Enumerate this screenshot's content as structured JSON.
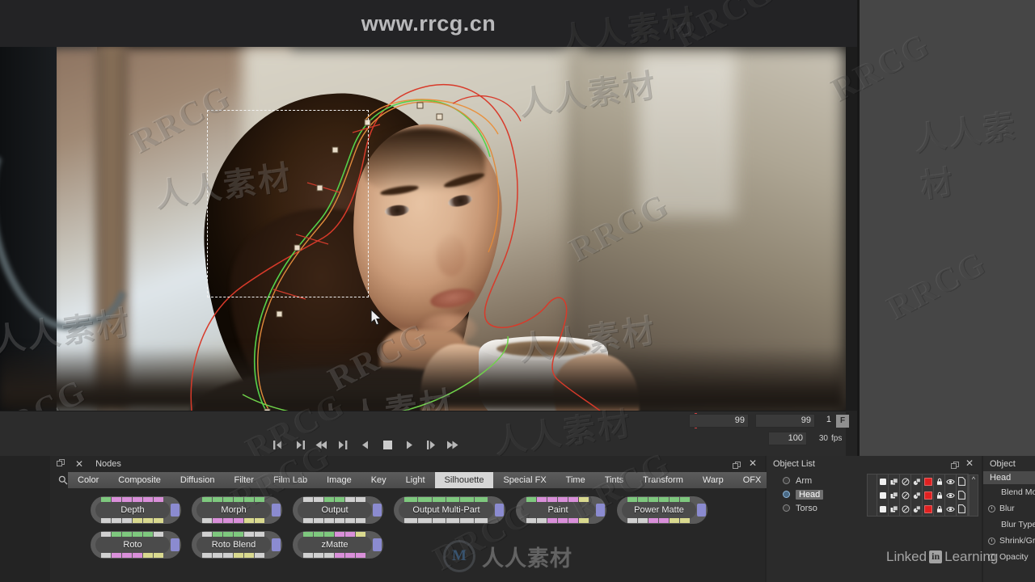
{
  "header": {
    "watermark": "www.rrcg.cn"
  },
  "viewer": {
    "marquee_label": "selection-marquee"
  },
  "transport": {
    "buttons": [
      {
        "name": "go-to-start",
        "glyph": "|◀"
      },
      {
        "name": "go-to-end",
        "glyph": "▶|"
      },
      {
        "name": "rewind",
        "glyph": "◀◀"
      },
      {
        "name": "step-back",
        "glyph": "◀|"
      },
      {
        "name": "play-backward",
        "glyph": "◀"
      },
      {
        "name": "stop",
        "glyph": "■"
      },
      {
        "name": "play-forward",
        "glyph": "▶"
      },
      {
        "name": "step-forward",
        "glyph": "|▶"
      },
      {
        "name": "fast-forward",
        "glyph": "▶▶"
      }
    ],
    "current_frame": "99",
    "end_frame": "99",
    "increment": "1",
    "unit_label": "F",
    "total_frames": "100",
    "fps_value": "30",
    "fps_label": "fps"
  },
  "nodes_panel": {
    "title": "Nodes",
    "search_icon": "search-icon",
    "float_icon": "float-panel-icon",
    "close_icon": "close-icon",
    "tabs": [
      {
        "label": "Color",
        "active": false
      },
      {
        "label": "Composite",
        "active": false
      },
      {
        "label": "Diffusion",
        "active": false
      },
      {
        "label": "Filter",
        "active": false
      },
      {
        "label": "Film Lab",
        "active": false
      },
      {
        "label": "Image",
        "active": false
      },
      {
        "label": "Key",
        "active": false
      },
      {
        "label": "Light",
        "active": false
      },
      {
        "label": "Silhouette",
        "active": true
      },
      {
        "label": "Special FX",
        "active": false
      },
      {
        "label": "Time",
        "active": false
      },
      {
        "label": "Tints",
        "active": false
      },
      {
        "label": "Transform",
        "active": false
      },
      {
        "label": "Warp",
        "active": false
      },
      {
        "label": "OFX",
        "active": false
      }
    ],
    "rows": [
      [
        {
          "label": "Depth",
          "wide": false,
          "top": [
            "g",
            "m",
            "m",
            "m",
            "m",
            "m"
          ],
          "bottom": [
            "w",
            "w",
            "w",
            "y",
            "y",
            "y"
          ]
        },
        {
          "label": "Morph",
          "wide": false,
          "top": [
            "g",
            "g",
            "g",
            "g",
            "g",
            "g"
          ],
          "bottom": [
            "w",
            "m",
            "m",
            "m",
            "y",
            "y"
          ]
        },
        {
          "label": "Output",
          "wide": false,
          "top": [
            "w",
            "w",
            "g",
            "g",
            "w",
            "w"
          ],
          "bottom": [
            "w",
            "w",
            "w",
            "w",
            "w",
            "w"
          ]
        },
        {
          "label": "Output Multi-Part",
          "wide": true,
          "top": [
            "g",
            "g",
            "g",
            "g",
            "g",
            "g"
          ],
          "bottom": [
            "w",
            "w",
            "w",
            "w",
            "w",
            "w"
          ]
        },
        {
          "label": "Paint",
          "wide": false,
          "top": [
            "g",
            "m",
            "m",
            "m",
            "m",
            "y"
          ],
          "bottom": [
            "w",
            "w",
            "m",
            "m",
            "m",
            "y"
          ]
        },
        {
          "label": "Power Matte",
          "wide": false,
          "top": [
            "g",
            "g",
            "g",
            "g",
            "g",
            "g"
          ],
          "bottom": [
            "w",
            "w",
            "m",
            "m",
            "y",
            "y"
          ]
        }
      ],
      [
        {
          "label": "Roto",
          "wide": false,
          "top": [
            "w",
            "g",
            "g",
            "g",
            "g",
            "w"
          ],
          "bottom": [
            "w",
            "m",
            "m",
            "m",
            "y",
            "y"
          ]
        },
        {
          "label": "Roto Blend",
          "wide": false,
          "top": [
            "w",
            "g",
            "g",
            "g",
            "w",
            "w"
          ],
          "bottom": [
            "w",
            "w",
            "w",
            "y",
            "y",
            "w"
          ]
        },
        {
          "label": "zMatte",
          "wide": false,
          "top": [
            "g",
            "g",
            "g",
            "m",
            "m",
            "y"
          ],
          "bottom": [
            "w",
            "w",
            "w",
            "m",
            "m",
            "m"
          ]
        }
      ]
    ]
  },
  "object_list": {
    "title": "Object List",
    "float_icon": "float-panel-icon",
    "close_icon": "close-icon",
    "items": [
      {
        "label": "Arm",
        "selected": false
      },
      {
        "label": "Head",
        "selected": true
      },
      {
        "label": "Torso",
        "selected": false
      }
    ],
    "column_icons": [
      "matte-icon",
      "layers-icon",
      "invert-icon",
      "duplicate-icon",
      "color-swatch-icon",
      "lock-icon",
      "visibility-eye-icon",
      "page-icon"
    ],
    "scroll_icon": "chevron-up-icon"
  },
  "object_panel": {
    "title": "Object",
    "selected": "Head",
    "properties": [
      {
        "label": "Blend Mode",
        "has_clock": false,
        "indent": true
      },
      {
        "label": "Blur",
        "has_clock": true,
        "indent": false
      },
      {
        "label": "Blur Type",
        "has_clock": false,
        "indent": true
      },
      {
        "label": "Shrink/Grow",
        "has_clock": true,
        "indent": false
      },
      {
        "label": "Opacity",
        "has_clock": true,
        "indent": false
      }
    ]
  },
  "watermarks": {
    "rrcg": "RRCG",
    "chinese": "人人素材",
    "logo_mark": "M",
    "linkedin_text_a": "Linked",
    "linkedin_badge": "in",
    "linkedin_text_b": "Learning"
  },
  "colors": {
    "panel_bg": "#272727",
    "viewer_bg": "#0b0b0b",
    "accent_active_tab": "#d6d6d6",
    "node_green": "#7ec87e",
    "node_magenta": "#d98fd9",
    "node_yellow": "#d9d98f",
    "node_white": "#d0d0d0",
    "node_port_blue": "#8b8bd0",
    "spline_green": "#55d24a",
    "spline_orange": "#e08a3c",
    "spline_red": "#d83a2a",
    "playhead_red": "#cf4141",
    "swatch_red": "#e02020"
  }
}
